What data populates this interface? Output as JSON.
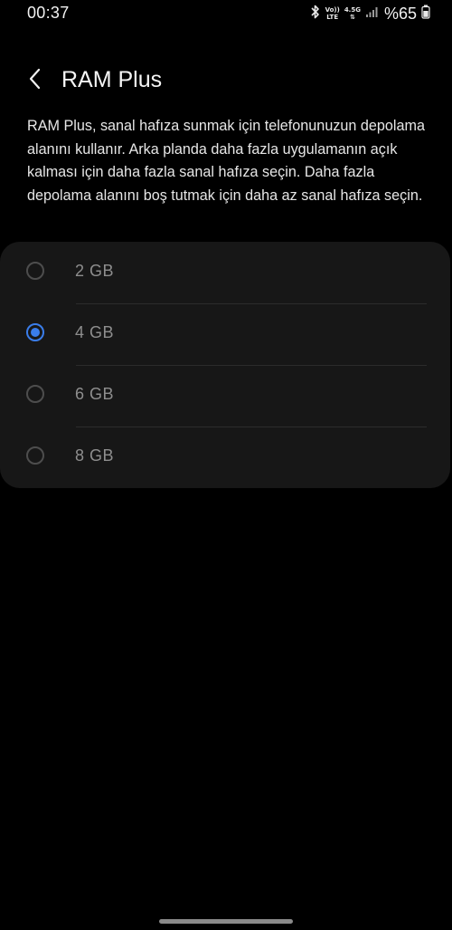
{
  "status_bar": {
    "time": "00:37",
    "network_top": "VoLTE 4.5G",
    "net_volte": "Vo))",
    "net_lte": "LTE",
    "net_gen": "4.5G",
    "battery": "%65",
    "icons": [
      "bluetooth-icon",
      "volte-icon",
      "signal-4g-icon",
      "signal-bars-icon",
      "battery-icon"
    ]
  },
  "header": {
    "title": "RAM Plus",
    "back_icon": "chevron-left-icon"
  },
  "description": "RAM Plus, sanal hafıza sunmak için telefonunuzun depolama alanını kullanır. Arka planda daha fazla uygulamanın açık kalması için daha fazla sanal hafıza seçin. Daha fazla depolama alanını boş tutmak için daha az sanal hafıza seçin.",
  "options": [
    {
      "label": "2 GB",
      "selected": false
    },
    {
      "label": "4 GB",
      "selected": true
    },
    {
      "label": "6 GB",
      "selected": false
    },
    {
      "label": "8 GB",
      "selected": false
    }
  ],
  "colors": {
    "background": "#000000",
    "card": "#171717",
    "accent": "#3a7dea",
    "option_text": "#8e8e8e"
  }
}
